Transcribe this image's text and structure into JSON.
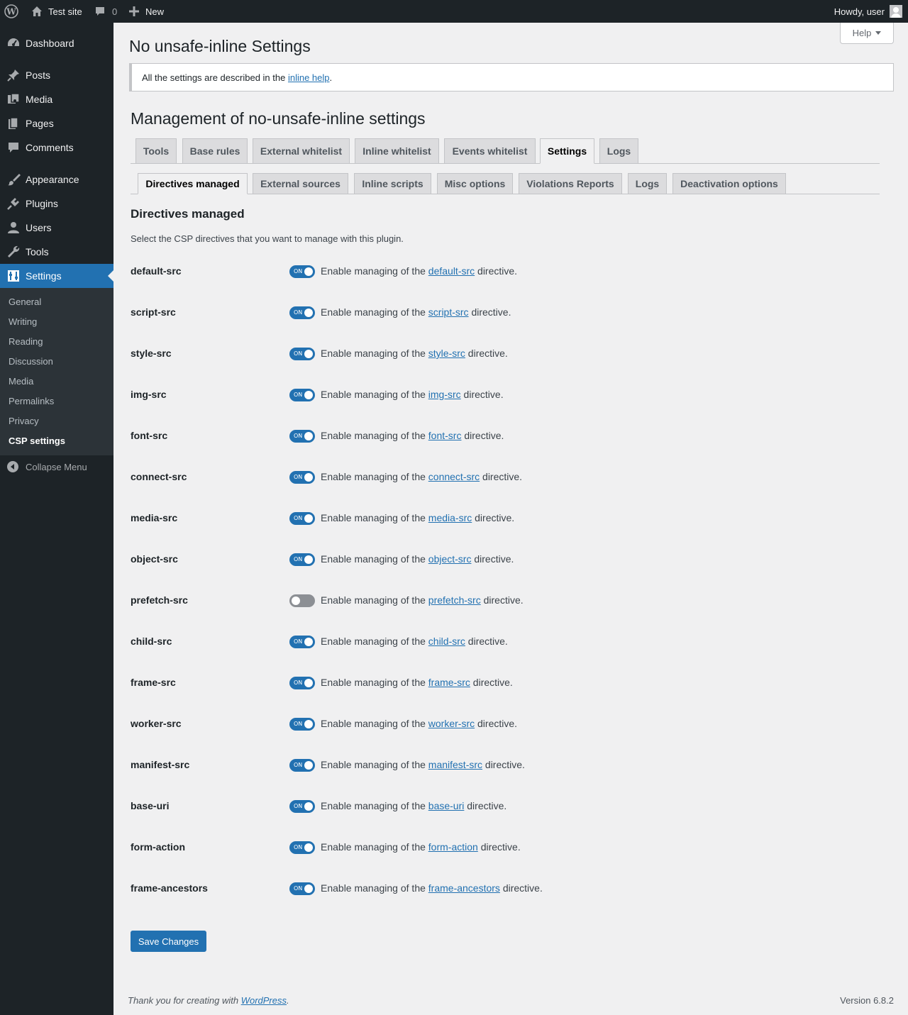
{
  "adminbar": {
    "site_name": "Test site",
    "comments_count": "0",
    "new_label": "New",
    "howdy": "Howdy, user"
  },
  "sidebar": {
    "items": [
      {
        "label": "Dashboard",
        "icon": "dashboard-icon"
      },
      {
        "label": "Posts",
        "icon": "pin-icon"
      },
      {
        "label": "Media",
        "icon": "media-icon"
      },
      {
        "label": "Pages",
        "icon": "pages-icon"
      },
      {
        "label": "Comments",
        "icon": "comment-icon"
      },
      {
        "label": "Appearance",
        "icon": "brush-icon"
      },
      {
        "label": "Plugins",
        "icon": "plug-icon"
      },
      {
        "label": "Users",
        "icon": "user-icon"
      },
      {
        "label": "Tools",
        "icon": "wrench-icon"
      },
      {
        "label": "Settings",
        "icon": "settings-icon"
      }
    ],
    "submenu": [
      "General",
      "Writing",
      "Reading",
      "Discussion",
      "Media",
      "Permalinks",
      "Privacy",
      "CSP settings"
    ],
    "collapse_label": "Collapse Menu"
  },
  "help_label": "Help",
  "page_title": "No unsafe-inline Settings",
  "notice": {
    "prefix": "All the settings are described in the ",
    "link": "inline help",
    "suffix": "."
  },
  "mgmt_title": "Management of no-unsafe-inline settings",
  "main_tabs": [
    "Tools",
    "Base rules",
    "External whitelist",
    "Inline whitelist",
    "Events whitelist",
    "Settings",
    "Logs"
  ],
  "sub_tabs": [
    "Directives managed",
    "External sources",
    "Inline scripts",
    "Misc options",
    "Violations Reports",
    "Logs",
    "Deactivation options"
  ],
  "section": {
    "title": "Directives managed",
    "description": "Select the CSP directives that you want to manage with this plugin."
  },
  "row_text": {
    "prefix": "Enable managing of the ",
    "suffix": " directive.",
    "on_label": "ON"
  },
  "directives": [
    {
      "name": "default-src",
      "enabled": true
    },
    {
      "name": "script-src",
      "enabled": true
    },
    {
      "name": "style-src",
      "enabled": true
    },
    {
      "name": "img-src",
      "enabled": true
    },
    {
      "name": "font-src",
      "enabled": true
    },
    {
      "name": "connect-src",
      "enabled": true
    },
    {
      "name": "media-src",
      "enabled": true
    },
    {
      "name": "object-src",
      "enabled": true
    },
    {
      "name": "prefetch-src",
      "enabled": false
    },
    {
      "name": "child-src",
      "enabled": true
    },
    {
      "name": "frame-src",
      "enabled": true
    },
    {
      "name": "worker-src",
      "enabled": true
    },
    {
      "name": "manifest-src",
      "enabled": true
    },
    {
      "name": "base-uri",
      "enabled": true
    },
    {
      "name": "form-action",
      "enabled": true
    },
    {
      "name": "frame-ancestors",
      "enabled": true
    }
  ],
  "save_label": "Save Changes",
  "footer": {
    "thanks_prefix": "Thank you for creating with ",
    "thanks_link": "WordPress",
    "thanks_suffix": ".",
    "version": "Version 6.8.2"
  },
  "colors": {
    "accent": "#2271b1",
    "sidebar_bg": "#1d2327",
    "page_bg": "#f0f0f1",
    "toggle_off": "#8c8f94"
  }
}
